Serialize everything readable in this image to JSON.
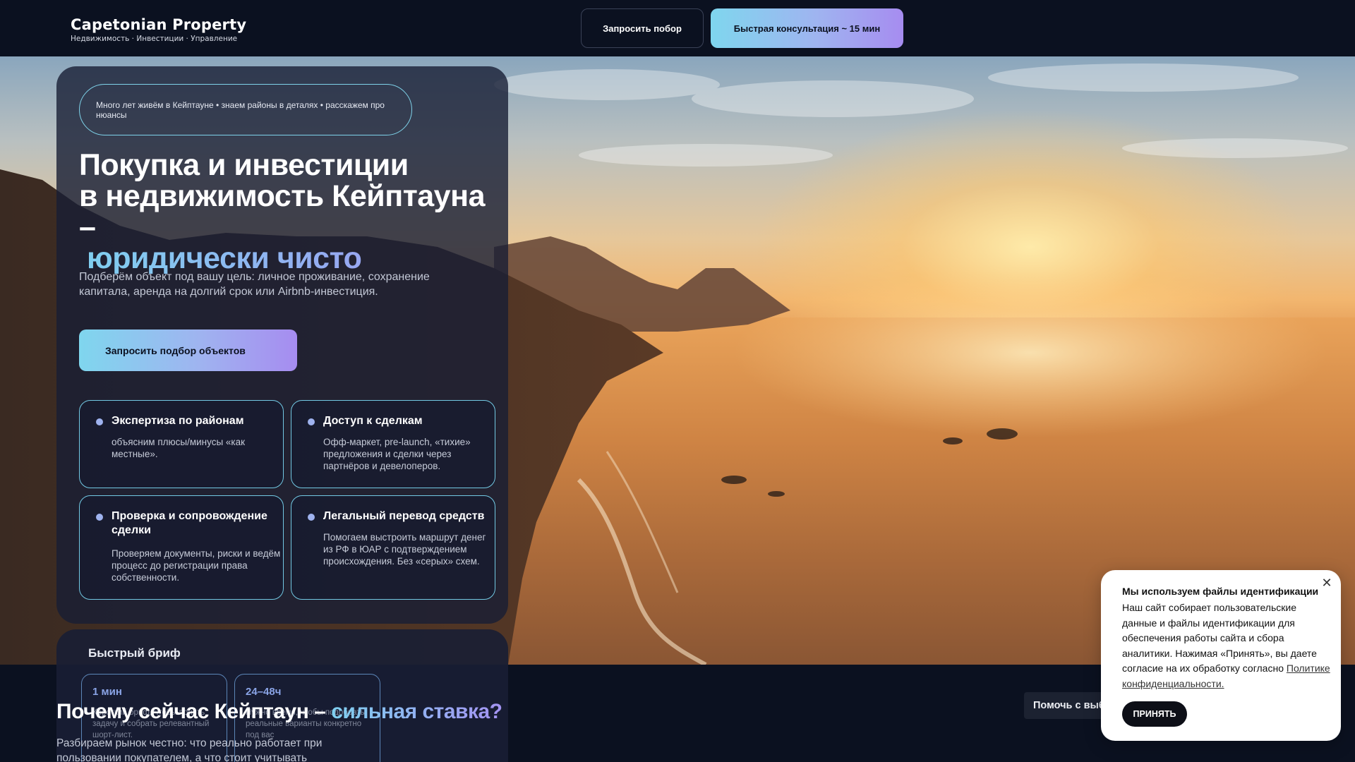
{
  "header": {
    "brand_name": "Capetonian Property",
    "brand_tagline": "Недвижимость · Инвестиции · Управление",
    "request_button": "Запросить побор",
    "consult_button": "Быстрая консультация ~ 15 мин"
  },
  "hero": {
    "pill_text": "Много лет живём в Кейптауне • знаем районы в деталях • расскажем про нюансы",
    "headline_line1": "Покупка и инвестиции",
    "headline_line2": "в недвижимость Кейптауна –",
    "headline_accent": "юридически чисто",
    "lead": "Подберём объект под вашу цель: личное проживание, сохранение капитала, аренда на долгий срок или Airbnb-инвестиция.",
    "cta_label": "Запросить подбор объектов",
    "features": [
      {
        "title": "Экспертиза по районам",
        "desc": "объясним плюсы/минусы «как местные»."
      },
      {
        "title": "Доступ к сделкам",
        "desc": "Офф-маркет, pre-launch, «тихие» предложения и сделки через партнёров и девелоперов."
      },
      {
        "title": "Проверка и сопровождение сделки",
        "desc": "Проверяем документы, риски и ведём процесс до регистрации права собственности."
      },
      {
        "title": "Легальный перевод средств",
        "desc": "Помогаем выстроить маршрут денег из РФ в ЮАР с подтверждением происхождения. Без «серых» схем."
      }
    ]
  },
  "brief": {
    "title": "Быстрый бриф",
    "boxes": [
      {
        "value": "1 мин",
        "text": "Короткий бриф, чтобы понять задачу и собрать релевантный шорт-лист."
      },
      {
        "value": "24–48ч",
        "text": "Нужно время, чтобы подобрать реальные варианты конкретно под вас"
      }
    ]
  },
  "section": {
    "title_main": "Почему сейчас Кейптаун –",
    "title_accent": "сильная ставка?",
    "lead": "Разбираем рынок честно: что реально работает при пользовании покупателем, а что стоит учитывать"
  },
  "help_chip": "Помочь с выбором",
  "cookie": {
    "title": "Мы используем файлы идентификации",
    "text": "Наш сайт собирает пользовательские данные и файлы идентификации для обеспечения работы сайта и сбора аналитики. Нажимая «Принять», вы даете согласие на их обработку согласно",
    "policy_link": "Политике конфиденциальности.",
    "accept_button": "ПРИНЯТЬ",
    "close_icon": "close-icon"
  },
  "colors": {
    "background": "#0b1120",
    "accent_cyan": "#7fd6ee",
    "accent_violet": "#a68cf0",
    "card": "#181e34"
  }
}
